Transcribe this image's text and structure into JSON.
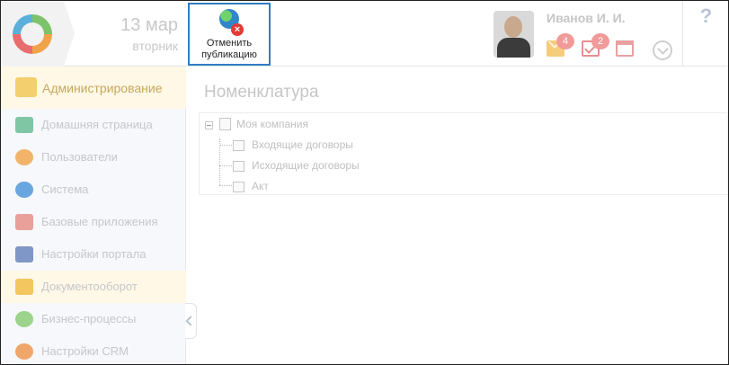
{
  "header": {
    "date_day": "13 мар",
    "date_weekday": "вторник",
    "unpublish_button_label": "Отменить публикацию",
    "user_name": "Иванов И. И.",
    "mail_count": "4",
    "task_count": "2",
    "help_label": "?"
  },
  "sidebar": {
    "section_title": "Администрирование",
    "items": [
      {
        "label": "Домашняя страница",
        "icon": "home-tiles-icon",
        "color": "#7fc6a4"
      },
      {
        "label": "Пользователи",
        "icon": "users-icon",
        "color": "#f2b36b"
      },
      {
        "label": "Система",
        "icon": "system-icon",
        "color": "#6aa6e0"
      },
      {
        "label": "Базовые приложения",
        "icon": "base-apps-icon",
        "color": "#e9a09a"
      },
      {
        "label": "Настройки портала",
        "icon": "portal-settings-icon",
        "color": "#7e97c7"
      },
      {
        "label": "Документооборот",
        "icon": "folder-icon",
        "color": "#f3c65f"
      },
      {
        "label": "Бизнес-процессы",
        "icon": "business-process-icon",
        "color": "#9bd48a"
      },
      {
        "label": "Настройки CRM",
        "icon": "crm-settings-icon",
        "color": "#f0a66b"
      }
    ]
  },
  "main": {
    "title": "Номенклатура",
    "tree": {
      "root": "Моя компания",
      "children": [
        "Входящие договоры",
        "Исходящие договоры",
        "Акт"
      ]
    }
  },
  "colors": {
    "selection_border": "#2e7ec5",
    "active_item_bg": "#fff8e6",
    "sidebar_bg": "#f6f8fb"
  }
}
